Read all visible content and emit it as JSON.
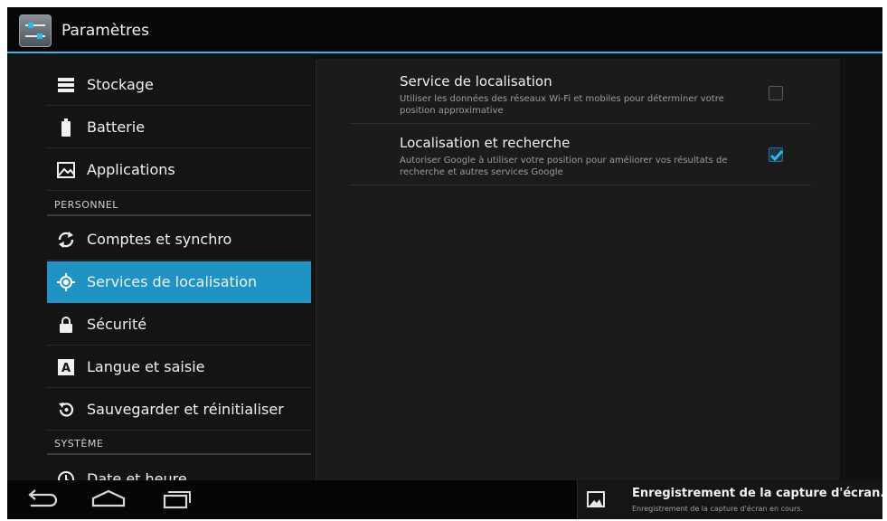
{
  "header": {
    "title": "Paramètres"
  },
  "sidebar": {
    "items_top": [
      {
        "label": "Stockage",
        "icon": "storage-icon"
      },
      {
        "label": "Batterie",
        "icon": "battery-icon"
      },
      {
        "label": "Applications",
        "icon": "applications-icon"
      }
    ],
    "section_personnel": "PERSONNEL",
    "items_personnel": [
      {
        "label": "Comptes et synchro",
        "icon": "sync-icon"
      },
      {
        "label": "Services de localisation",
        "icon": "location-icon",
        "selected": true
      },
      {
        "label": "Sécurité",
        "icon": "lock-icon"
      },
      {
        "label": "Langue et saisie",
        "icon": "keyboard-icon"
      },
      {
        "label": "Sauvegarder et réinitialiser",
        "icon": "backup-icon"
      }
    ],
    "section_systeme": "SYSTÈME",
    "items_systeme": [
      {
        "label": "Date et heure",
        "icon": "clock-icon"
      }
    ]
  },
  "preferences": [
    {
      "title": "Service de localisation",
      "summary": "Utiliser les données des réseaux Wi-Fi et mobiles pour déterminer votre position approximative",
      "checked": false
    },
    {
      "title": "Localisation et recherche",
      "summary": "Autoriser Google à utiliser votre position pour améliorer vos résultats de recherche et autres services Google",
      "checked": true
    }
  ],
  "notification": {
    "title": "Enregistrement de la capture d'écran...",
    "subtitle": "Enregistrement de la capture d'écran en cours."
  },
  "colors": {
    "accent": "#33b5e5",
    "selected": "#1f93c4"
  }
}
